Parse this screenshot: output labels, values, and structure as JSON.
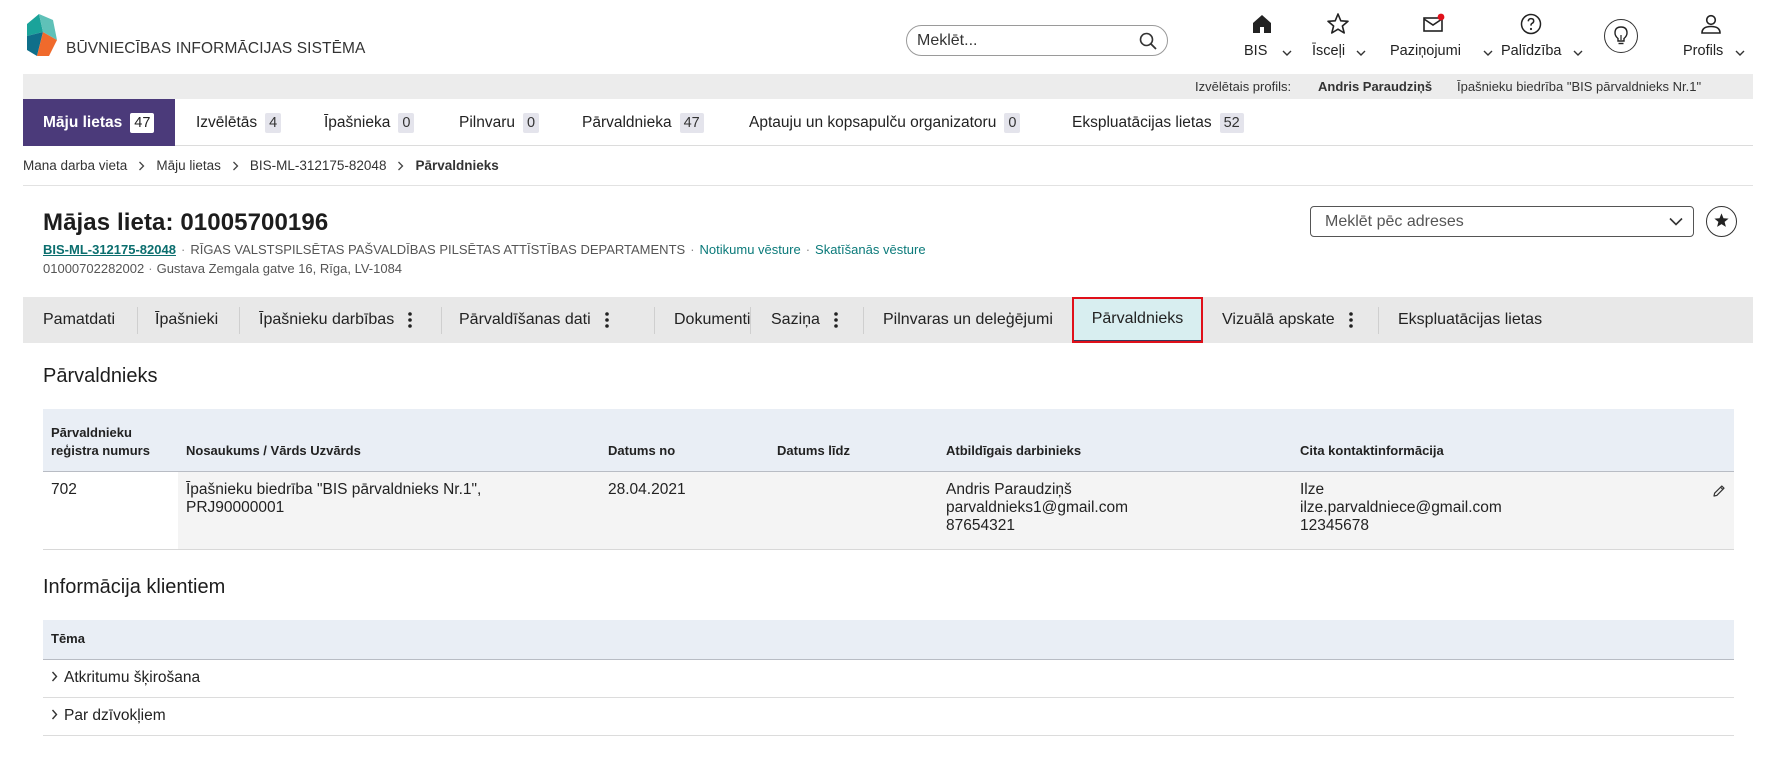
{
  "header": {
    "brand": "BŪVNIECĪBAS INFORMĀCIJAS SISTĒMA",
    "search_placeholder": "Meklēt...",
    "nav": {
      "bis": "BIS",
      "shortcuts": "Īsceļi",
      "notifications": "Paziņojumi",
      "help": "Palīdzība",
      "profile": "Profils"
    },
    "notification_dot_color": "#e0101a"
  },
  "profile_strip": {
    "label": "Izvēlētais profils:",
    "name": "Andris Paraudziņš",
    "organization": "Īpašnieku biedrība \"BIS pārvaldnieks Nr.1\""
  },
  "main_tabs": [
    {
      "label": "Māju lietas",
      "count": "47",
      "active": true
    },
    {
      "label": "Izvēlētās",
      "count": "4"
    },
    {
      "label": "Īpašnieka",
      "count": "0"
    },
    {
      "label": "Pilnvaru",
      "count": "0"
    },
    {
      "label": "Pārvaldnieka",
      "count": "47"
    },
    {
      "label": "Aptauju un kopsapulču organizatoru",
      "count": "0"
    },
    {
      "label": "Ekspluatācijas lietas",
      "count": "52"
    }
  ],
  "breadcrumb": [
    "Mana darba vieta",
    "Māju lietas",
    "BIS-ML-312175-82048",
    "Pārvaldnieks"
  ],
  "case": {
    "title": "Mājas lieta: 01005700196",
    "case_id": "BIS-ML-312175-82048",
    "department": "RĪGAS VALSTSPILSĒTAS PAŠVALDĪBAS PILSĒTAS ATTĪSTĪBAS DEPARTAMENTS",
    "events_link": "Notikumu vēsture",
    "views_link": "Skatīšanās vēsture",
    "cadastre": "01000702282002",
    "address": "Gustava Zemgala gatve 16, Rīga, LV-1084",
    "address_search_placeholder": "Meklēt pēc adreses"
  },
  "sub_tabs": [
    {
      "label": "Pamatdati"
    },
    {
      "label": "Īpašnieki"
    },
    {
      "label": "Īpašnieku darbības",
      "menu": true
    },
    {
      "label": "Pārvaldīšanas dati",
      "menu": true
    },
    {
      "label": "Dokumenti"
    },
    {
      "label": "Saziņa",
      "menu": true
    },
    {
      "label": "Pilnvaras un deleģējumi"
    },
    {
      "label": "Pārvaldnieks",
      "active": true
    },
    {
      "label": "Vizuālā apskate",
      "menu": true
    },
    {
      "label": "Ekspluatācijas lietas"
    }
  ],
  "manager_section": {
    "title": "Pārvaldnieks",
    "headers": {
      "reg_number_line1": "Pārvaldnieku",
      "reg_number_line2": "reģistra numurs",
      "name": "Nosaukums / Vārds Uzvārds",
      "date_from": "Datums no",
      "date_to": "Datums līdz",
      "responsible": "Atbildīgais darbinieks",
      "other_contacts": "Cita kontaktinformācija"
    },
    "row": {
      "reg_number": "702",
      "name_line1": "Īpašnieku biedrība \"BIS pārvaldnieks Nr.1\",",
      "name_line2": "PRJ90000001",
      "date_from": "28.04.2021",
      "date_to": "",
      "responsible_name": "Andris Paraudziņš",
      "responsible_email": "parvaldnieks1@gmail.com",
      "responsible_phone": "87654321",
      "contact_name": "Ilze",
      "contact_email": "ilze.parvaldniece@gmail.com",
      "contact_phone": "12345678"
    }
  },
  "client_info": {
    "title": "Informācija klientiem",
    "header": "Tēma",
    "topics": [
      "Atkritumu šķirošana",
      "Par dzīvokļiem"
    ]
  },
  "colors": {
    "active_main_tab": "#4b3a7a",
    "active_sub_tab_bg": "#d8eef0",
    "highlight_outline": "#e0101a",
    "link_teal": "#0b7a7a",
    "table_header_bg": "#e9eef5"
  }
}
